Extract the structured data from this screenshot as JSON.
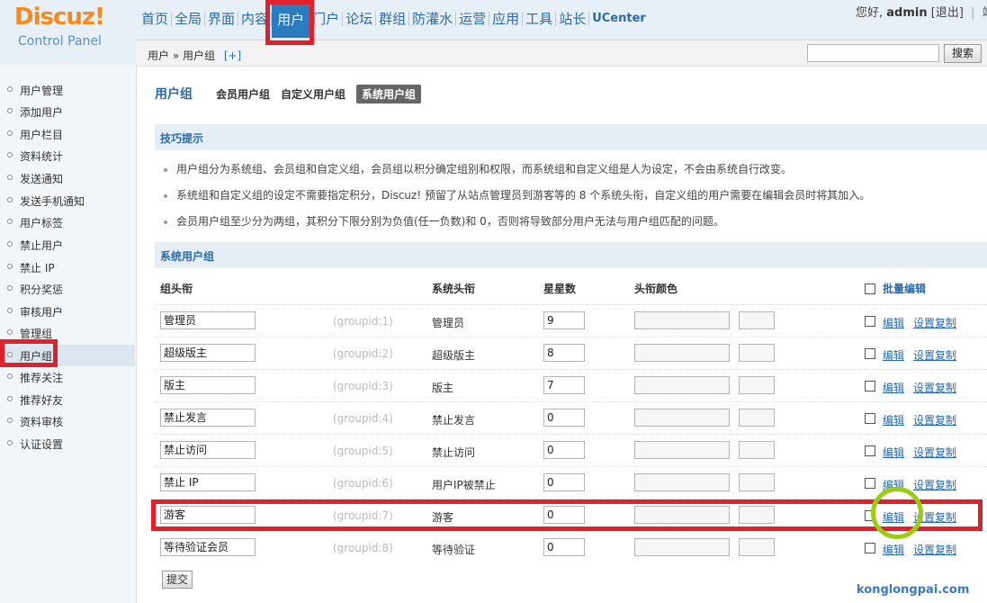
{
  "logo": {
    "title": "Discuz!",
    "subtitle": "Control Panel"
  },
  "topnav": [
    "首页",
    "全局",
    "界面",
    "内容",
    "用户",
    "门户",
    "论坛",
    "群组",
    "防灌水",
    "运营",
    "应用",
    "工具",
    "站长",
    "UCenter"
  ],
  "topnav_active": "用户",
  "user": {
    "greeting": "您好,",
    "name": "admin",
    "logout": "[退出]",
    "extra": "站"
  },
  "breadcrumb": {
    "path": "用户 » 用户组",
    "add": "[+]"
  },
  "search": {
    "button": "搜索",
    "value": ""
  },
  "sidebar": {
    "items": [
      "用户管理",
      "添加用户",
      "用户栏目",
      "资料统计",
      "发送通知",
      "发送手机通知",
      "用户标签",
      "禁止用户",
      "禁止 IP",
      "积分奖惩",
      "审核用户",
      "管理组",
      "用户组",
      "推荐关注",
      "推荐好友",
      "资料审核",
      "认证设置"
    ],
    "active": "用户组"
  },
  "tabs": {
    "title": "用户组",
    "items": [
      "会员用户组",
      "自定义用户组",
      "系统用户组"
    ],
    "current": "系统用户组"
  },
  "tips": {
    "header": "技巧提示",
    "lines": [
      "用户组分为系统组、会员组和自定义组，会员组以积分确定组别和权限，而系统组和自定义组是人为设定，不会由系统自行改变。",
      "系统组和自定义组的设定不需要指定积分，Discuz! 预留了从站点管理员到游客等的 8 个系统头衔，自定义组的用户需要在编辑会员时将其加入。",
      "会员用户组至少分为两组，其积分下限分别为负值(任一负数)和 0，否则将导致部分用户无法与用户组匹配的问题。"
    ]
  },
  "table": {
    "header": "系统用户组",
    "columns": {
      "name": "组头衔",
      "system": "系统头衔",
      "stars": "星星数",
      "color": "头衔颜色",
      "batch": "批量编辑"
    },
    "rows": [
      {
        "name": "管理员",
        "gid": "(groupid:1)",
        "system": "管理员",
        "stars": "9"
      },
      {
        "name": "超级版主",
        "gid": "(groupid:2)",
        "system": "超级版主",
        "stars": "8"
      },
      {
        "name": "版主",
        "gid": "(groupid:3)",
        "system": "版主",
        "stars": "7"
      },
      {
        "name": "禁止发言",
        "gid": "(groupid:4)",
        "system": "禁止发言",
        "stars": "0"
      },
      {
        "name": "禁止访问",
        "gid": "(groupid:5)",
        "system": "禁止访问",
        "stars": "0"
      },
      {
        "name": "禁止 IP",
        "gid": "(groupid:6)",
        "system": "用户IP被禁止",
        "stars": "0"
      },
      {
        "name": "游客",
        "gid": "(groupid:7)",
        "system": "游客",
        "stars": "0"
      },
      {
        "name": "等待验证会员",
        "gid": "(groupid:8)",
        "system": "等待验证",
        "stars": "0"
      }
    ],
    "edit_label": "编辑",
    "copy_label": "设置复制",
    "submit": "提交"
  },
  "annotation_colors": {
    "highlight_box": "#e2202c",
    "circle": "#9acd12"
  },
  "watermark": "konglongpai.com"
}
